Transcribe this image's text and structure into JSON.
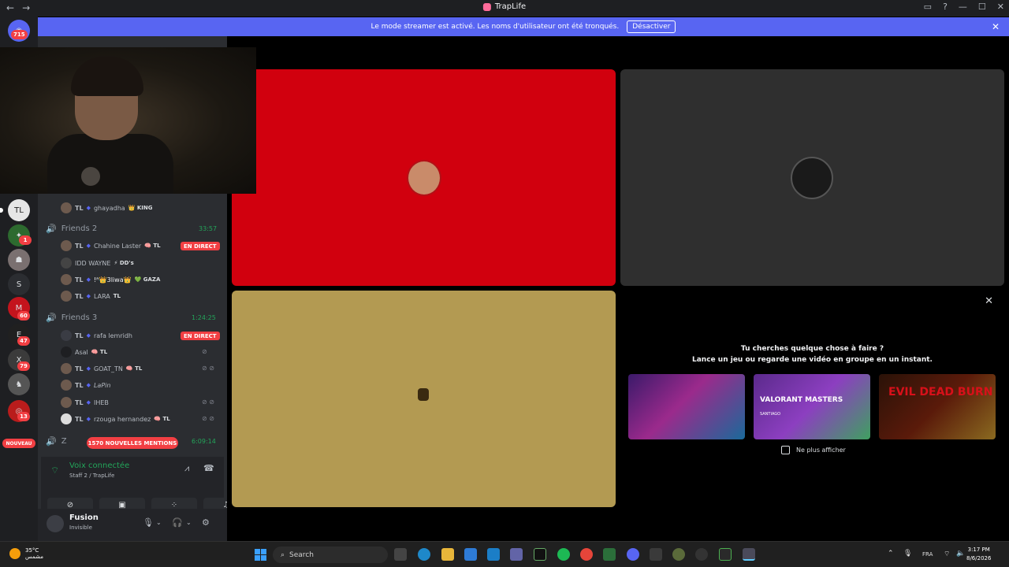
{
  "window": {
    "title": "TrapLife",
    "back": "←",
    "forward": "→",
    "controls": [
      "▭",
      "?",
      "—",
      "☐",
      "✕"
    ]
  },
  "banner": {
    "text": "Le mode streamer est activé. Les noms d'utilisateur ont été tronqués.",
    "button": "Désactiver",
    "close": "✕"
  },
  "rail": {
    "badges": {
      "top": "715",
      "b1": "1",
      "b2": "60",
      "b3": "47",
      "b4": "79",
      "b5": "13"
    },
    "letter_server": "S",
    "new_label": "NOUVEAU"
  },
  "channels": {
    "friends2": {
      "name": "Friends 2",
      "time": "33:57"
    },
    "friends3": {
      "name": "Friends 3",
      "time": "1:24:25"
    },
    "friends4": {
      "name": "Z",
      "time": "6:09:14"
    },
    "mentions": "1570 NOUVELLES MENTIONS",
    "live": "EN DIRECT"
  },
  "members": [
    {
      "tl": "TL",
      "name": "ghayadha",
      "tag": "👑 KING"
    },
    {
      "tl": "TL",
      "name": "Chahine Laster",
      "tag": "🧠 TL"
    },
    {
      "tl": "",
      "name": "IDD WAYNE",
      "tag": "⚡ DD's"
    },
    {
      "tl": "TL",
      "name": "!ᴿ👑3liwa👑",
      "tag": "💚 GAZA"
    },
    {
      "tl": "TL",
      "name": "LARA",
      "tag": "TL"
    },
    {
      "tl": "TL",
      "name": "rafa lemridh",
      "tag": ""
    },
    {
      "tl": "",
      "name": "Asal",
      "tag": "🧠 TL"
    },
    {
      "tl": "TL",
      "name": "GOAT_TN",
      "tag": "🧠 TL"
    },
    {
      "tl": "TL",
      "name": "LaPin",
      "tag": ""
    },
    {
      "tl": "TL",
      "name": "IHEB",
      "tag": ""
    },
    {
      "tl": "TL",
      "name": "rzouga hernandez",
      "tag": "🧠 TL"
    }
  ],
  "voice": {
    "status": "Voix connectée",
    "channel": "Staff 2 / TrapLife"
  },
  "user": {
    "name": "Fusion",
    "status": "Invisible"
  },
  "activity": {
    "title": "Tu cherches quelque chose à faire ?",
    "subtitle": "Lance un jeu ou regarde une vidéo en groupe en un instant.",
    "cards": [
      {
        "label": "",
        "sub": ""
      },
      {
        "label": "VALORANT MASTERS",
        "sub": "SANTIAGO"
      },
      {
        "label": "EVIL DEAD BURN",
        "sub": ""
      }
    ],
    "checkbox": "Ne plus afficher",
    "close": "✕"
  },
  "taskbar": {
    "temp": "35°C",
    "weather": "مشمس",
    "search": "Search",
    "lang": "FRA",
    "time": "3:17 PM",
    "date": "8/6/2026"
  },
  "colors": {
    "accent": "#5865f2",
    "live": "#f23f43",
    "voice": "#23a55a",
    "tile_red": "#d1000e",
    "tile_gray": "#2f2f2f",
    "tile_gold": "#b39a52"
  }
}
